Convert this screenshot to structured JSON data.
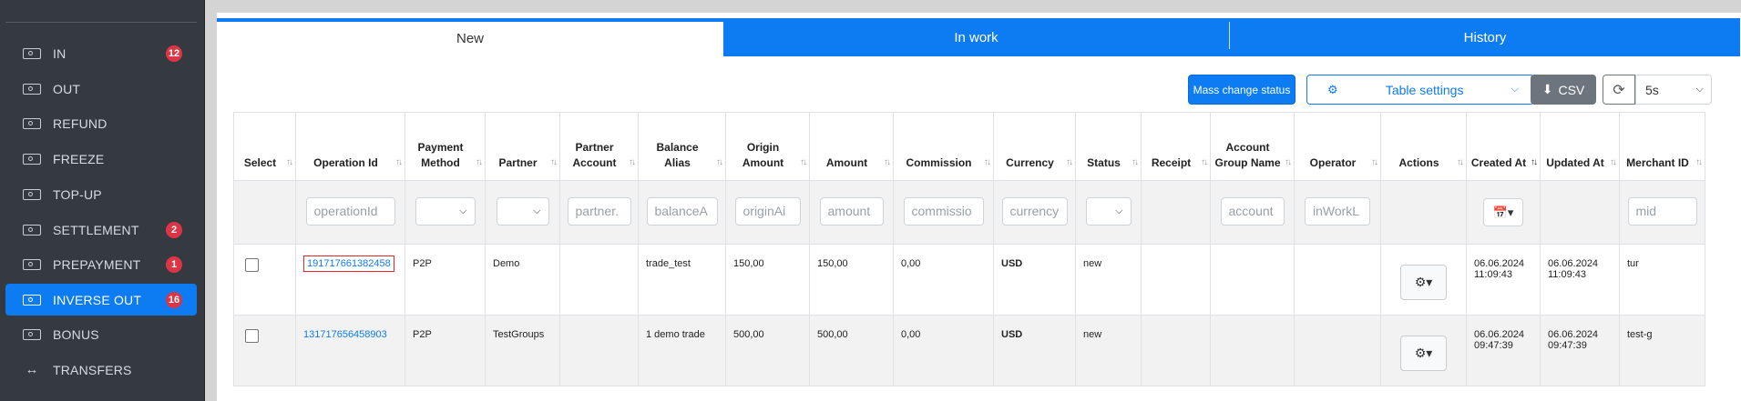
{
  "sidebar": {
    "items": [
      {
        "label": "IN",
        "badge": "12",
        "icon": "money-icon"
      },
      {
        "label": "OUT",
        "badge": "",
        "icon": "money-icon"
      },
      {
        "label": "REFUND",
        "badge": "",
        "icon": "money-icon"
      },
      {
        "label": "FREEZE",
        "badge": "",
        "icon": "money-icon"
      },
      {
        "label": "TOP-UP",
        "badge": "",
        "icon": "money-icon"
      },
      {
        "label": "SETTLEMENT",
        "badge": "2",
        "icon": "money-icon"
      },
      {
        "label": "PREPAYMENT",
        "badge": "1",
        "icon": "money-icon"
      },
      {
        "label": "INVERSE OUT",
        "badge": "16",
        "icon": "money-icon",
        "active": true
      },
      {
        "label": "BONUS",
        "badge": "",
        "icon": "money-icon"
      },
      {
        "label": "TRANSFERS",
        "badge": "",
        "icon": "arrows-horizontal-icon"
      }
    ]
  },
  "tabs": [
    {
      "label": "New",
      "active": true
    },
    {
      "label": "In work"
    },
    {
      "label": "History"
    }
  ],
  "toolbar": {
    "mass_change_label": "Mass change status",
    "table_settings_label": "Table settings",
    "csv_label": "CSV",
    "interval_value": "5s"
  },
  "table": {
    "columns": [
      {
        "key": "select",
        "label": "Select"
      },
      {
        "key": "operation_id",
        "label": "Operation Id"
      },
      {
        "key": "payment_method",
        "label": "Payment Method"
      },
      {
        "key": "partner",
        "label": "Partner"
      },
      {
        "key": "partner_account",
        "label": "Partner Account"
      },
      {
        "key": "balance_alias",
        "label": "Balance Alias"
      },
      {
        "key": "origin_amount",
        "label": "Origin Amount"
      },
      {
        "key": "amount",
        "label": "Amount"
      },
      {
        "key": "commission",
        "label": "Commission"
      },
      {
        "key": "currency",
        "label": "Currency"
      },
      {
        "key": "status",
        "label": "Status"
      },
      {
        "key": "receipt",
        "label": "Receipt"
      },
      {
        "key": "account_group_name",
        "label": "Account Group Name"
      },
      {
        "key": "operator",
        "label": "Operator"
      },
      {
        "key": "actions",
        "label": "Actions"
      },
      {
        "key": "created_at",
        "label": "Created At"
      },
      {
        "key": "updated_at",
        "label": "Updated At"
      },
      {
        "key": "merchant_id",
        "label": "Merchant ID"
      }
    ],
    "filters": {
      "operation_id": "operationId",
      "partner_account": "partner.",
      "balance_alias": "balanceA",
      "origin_amount": "originAi",
      "amount": "amount",
      "commission": "commissio",
      "currency": "currency",
      "account_group_name": "account",
      "operator": "inWorkL",
      "merchant_id": "mid"
    },
    "rows": [
      {
        "operation_id": "191717661382458",
        "payment_method": "P2P",
        "partner": "Demo",
        "partner_account": "",
        "balance_alias": "trade_test",
        "origin_amount": "150,00",
        "amount": "150,00",
        "commission": "0,00",
        "currency": "USD",
        "status": "new",
        "receipt": "",
        "account_group_name": "",
        "operator": "",
        "created_at_date": "06.06.2024",
        "created_at_time": "11:09:43",
        "updated_at_date": "06.06.2024",
        "updated_at_time": "11:09:43",
        "merchant_id": "tur"
      },
      {
        "operation_id": "131717656458903",
        "payment_method": "P2P",
        "partner": "TestGroups",
        "partner_account": "",
        "balance_alias": "1 demo trade",
        "origin_amount": "500,00",
        "amount": "500,00",
        "commission": "0,00",
        "currency": "USD",
        "status": "new",
        "receipt": "",
        "account_group_name": "",
        "operator": "",
        "created_at_date": "06.06.2024",
        "created_at_time": "09:47:39",
        "updated_at_date": "06.06.2024",
        "updated_at_time": "09:47:39",
        "merchant_id": "test-g"
      }
    ]
  },
  "colors": {
    "accent": "#0d7cf2",
    "sidebar_bg": "#343a40",
    "badge": "#dc3545"
  }
}
